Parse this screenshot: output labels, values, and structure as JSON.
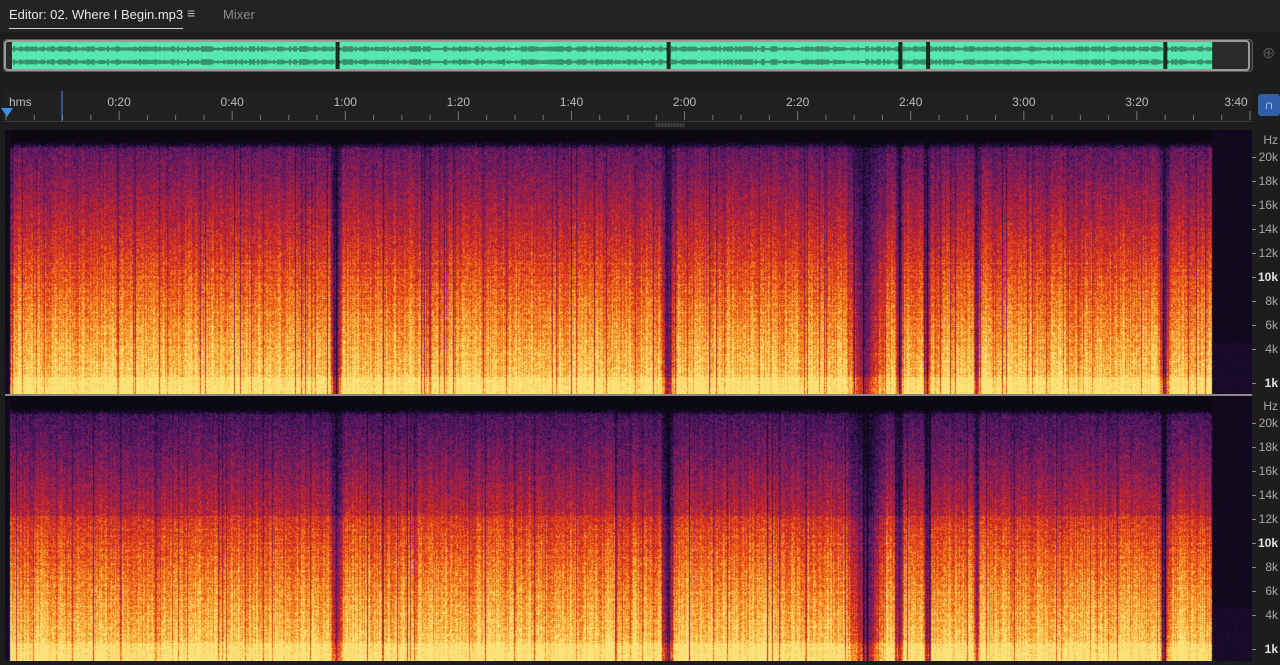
{
  "tabs": {
    "editor_label": "Editor: 02. Where I Begin.mp3",
    "mixer_label": "Mixer",
    "menu_icon": "hamburger-icon"
  },
  "overview": {
    "waveform_color": "#57e8b0",
    "dark_marks_at_seconds": [
      59,
      119,
      161,
      166,
      209
    ]
  },
  "ruler": {
    "unit": "hms",
    "ticks": [
      "0:20",
      "0:40",
      "1:00",
      "1:20",
      "1:40",
      "2:00",
      "2:20",
      "2:40",
      "3:00",
      "3:20",
      "3:40"
    ],
    "duration_seconds": 220,
    "playhead_color": "#3b8ee6"
  },
  "spectral": {
    "hz_label": "Hz",
    "freq_labels": [
      "20k",
      "18k",
      "16k",
      "14k",
      "12k",
      "10k",
      "8k",
      "6k",
      "4k",
      "1k"
    ],
    "bold_labels": [
      "10k",
      "1k"
    ],
    "quiet_bands_seconds": [
      {
        "center": 59,
        "width": 1.2
      },
      {
        "center": 119,
        "width": 1.2
      },
      {
        "center": 155,
        "width": 3.5
      },
      {
        "center": 161,
        "width": 0.8
      },
      {
        "center": 166,
        "width": 0.8
      },
      {
        "center": 175,
        "width": 0.6
      },
      {
        "center": 209,
        "width": 1.0
      }
    ],
    "audio_end_seconds": 217.5,
    "palette": [
      "#0b0812",
      "#2a0f4a",
      "#5a1a6e",
      "#9b1e4a",
      "#d9271c",
      "#f06a14",
      "#f9b23a",
      "#fbe27a"
    ]
  }
}
